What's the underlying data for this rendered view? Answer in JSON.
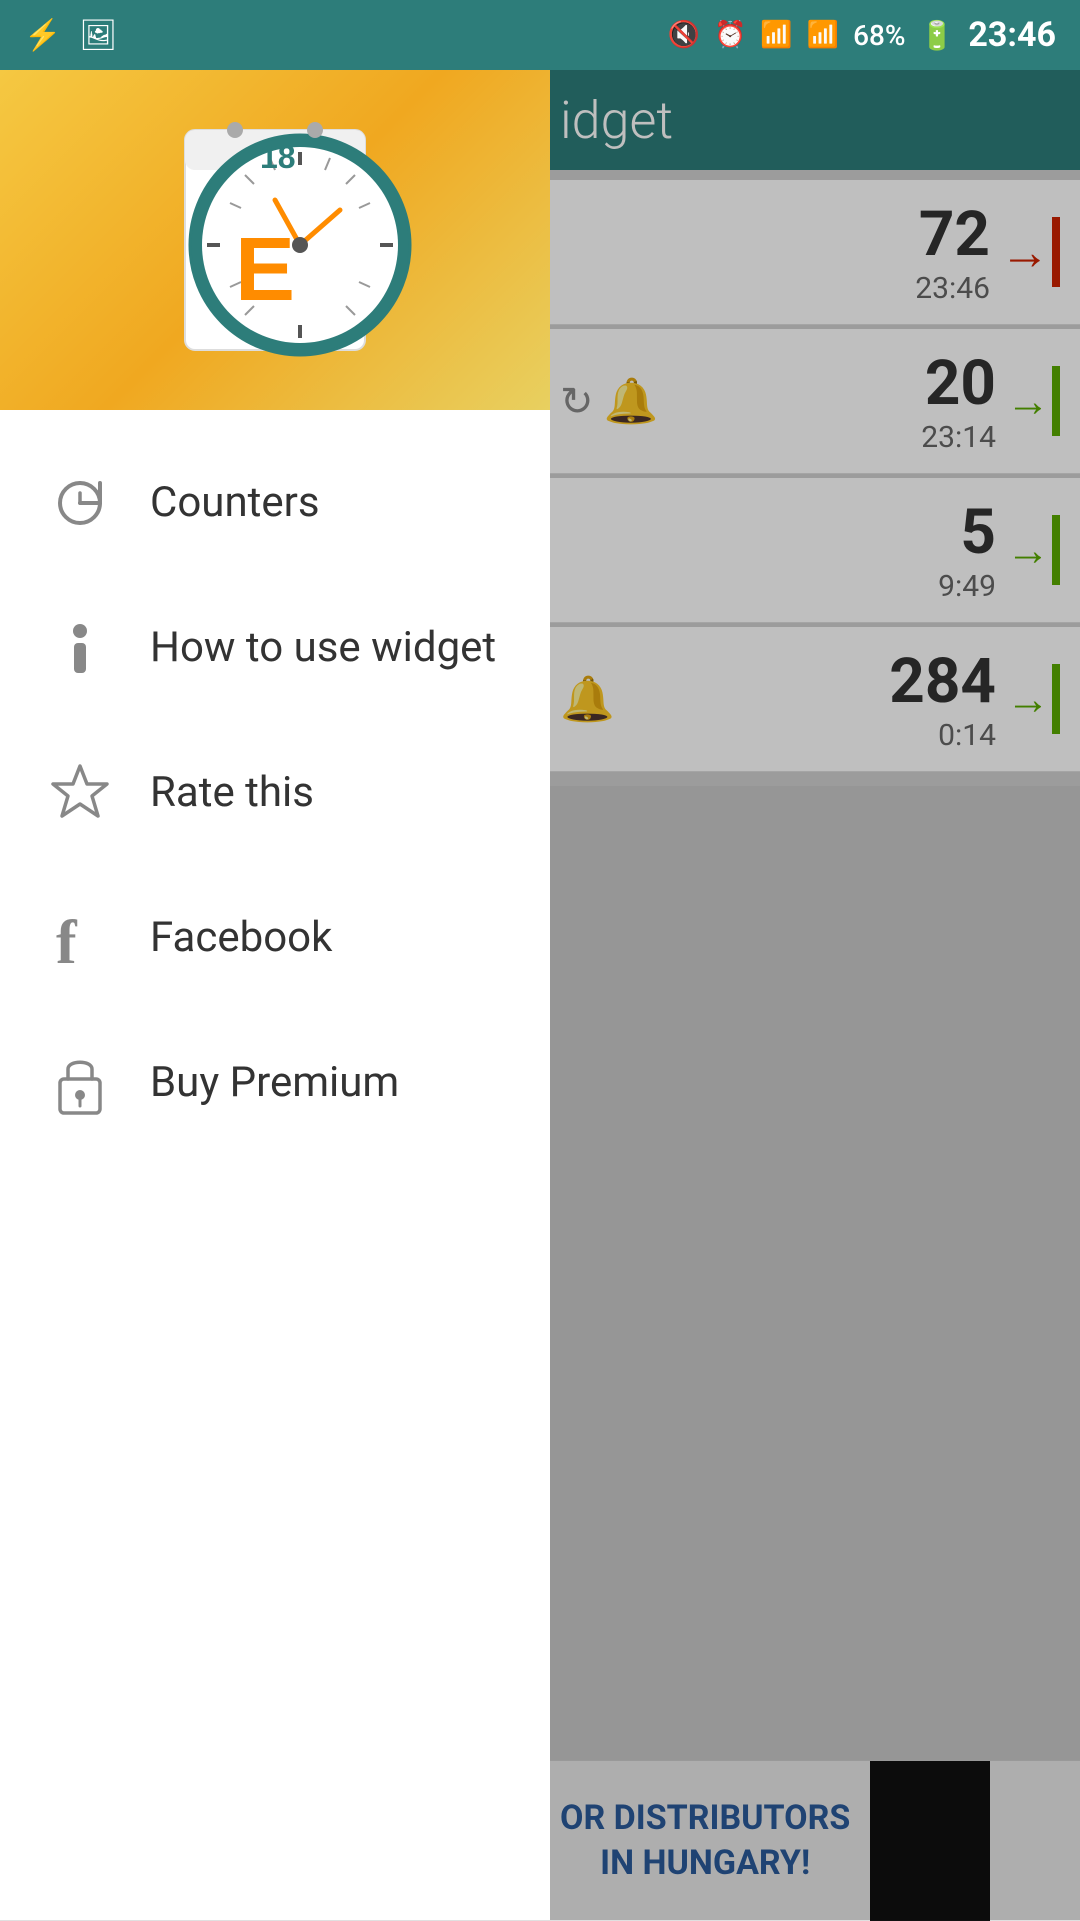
{
  "statusBar": {
    "time": "23:46",
    "battery": "68%",
    "icons": [
      "usb-icon",
      "image-icon",
      "mute-icon",
      "alarm-icon",
      "wifi-icon",
      "signal-icon",
      "battery-icon"
    ]
  },
  "mainHeader": {
    "title": "idget"
  },
  "counters": [
    {
      "number": "72",
      "time": "23:46",
      "arrowType": "red",
      "icons": []
    },
    {
      "number": "20",
      "time": "23:14",
      "arrowType": "green",
      "icons": [
        "refresh",
        "bell"
      ]
    },
    {
      "number": "5",
      "time": "9:49",
      "arrowType": "green",
      "icons": []
    },
    {
      "number": "284",
      "time": "0:14",
      "arrowType": "green",
      "icons": [
        "bell"
      ]
    }
  ],
  "adBanner": {
    "line1": "OR DISTRIBUTORS",
    "line2": "IN HUNGARY!"
  },
  "drawer": {
    "menuItems": [
      {
        "id": "counters",
        "label": "Counters",
        "icon": "history-icon"
      },
      {
        "id": "how-to-use",
        "label": "How to use widget",
        "icon": "info-icon"
      },
      {
        "id": "rate-this",
        "label": "Rate this",
        "icon": "star-icon"
      },
      {
        "id": "facebook",
        "label": "Facebook",
        "icon": "facebook-icon"
      },
      {
        "id": "buy-premium",
        "label": "Buy Premium",
        "icon": "lock-icon"
      }
    ]
  }
}
